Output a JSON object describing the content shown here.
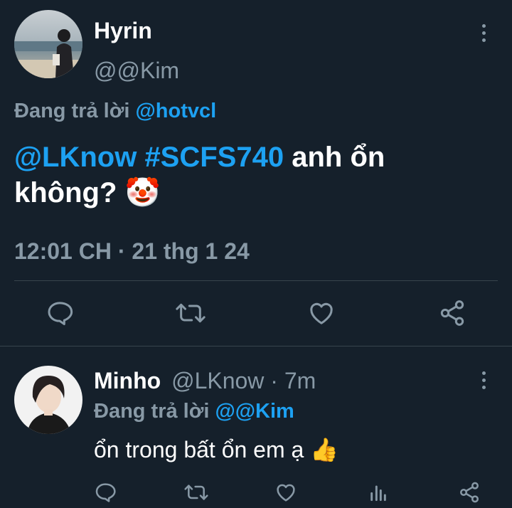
{
  "tweet": {
    "author_name": "Hyrin",
    "author_handle": "@@Kim",
    "reply_prefix": "Đang trả lời",
    "reply_to": "@hotvcl",
    "body": {
      "mention": "@LKnow",
      "hashtag": "#SCFS740",
      "text_1": "anh ổn",
      "text_2": "không?",
      "emoji": "🤡"
    },
    "timestamp": "12:01 CH · 21 thg 1 24",
    "actions": [
      "reply-icon",
      "retweet-icon",
      "like-icon",
      "share-icon"
    ]
  },
  "reply": {
    "author_name": "Minho",
    "author_handle": "@LKnow",
    "time": "· 7m",
    "reply_prefix": "Đang trả lời",
    "reply_to": "@@Kim",
    "text": "ổn trong bất ổn em ạ",
    "emoji": "👍",
    "actions": [
      "reply-icon",
      "retweet-icon",
      "like-icon",
      "analytics-icon",
      "share-icon"
    ]
  },
  "colors": {
    "background": "#15202b",
    "accent": "#1da1f2",
    "muted": "#8899a6",
    "divider": "#38444d"
  }
}
